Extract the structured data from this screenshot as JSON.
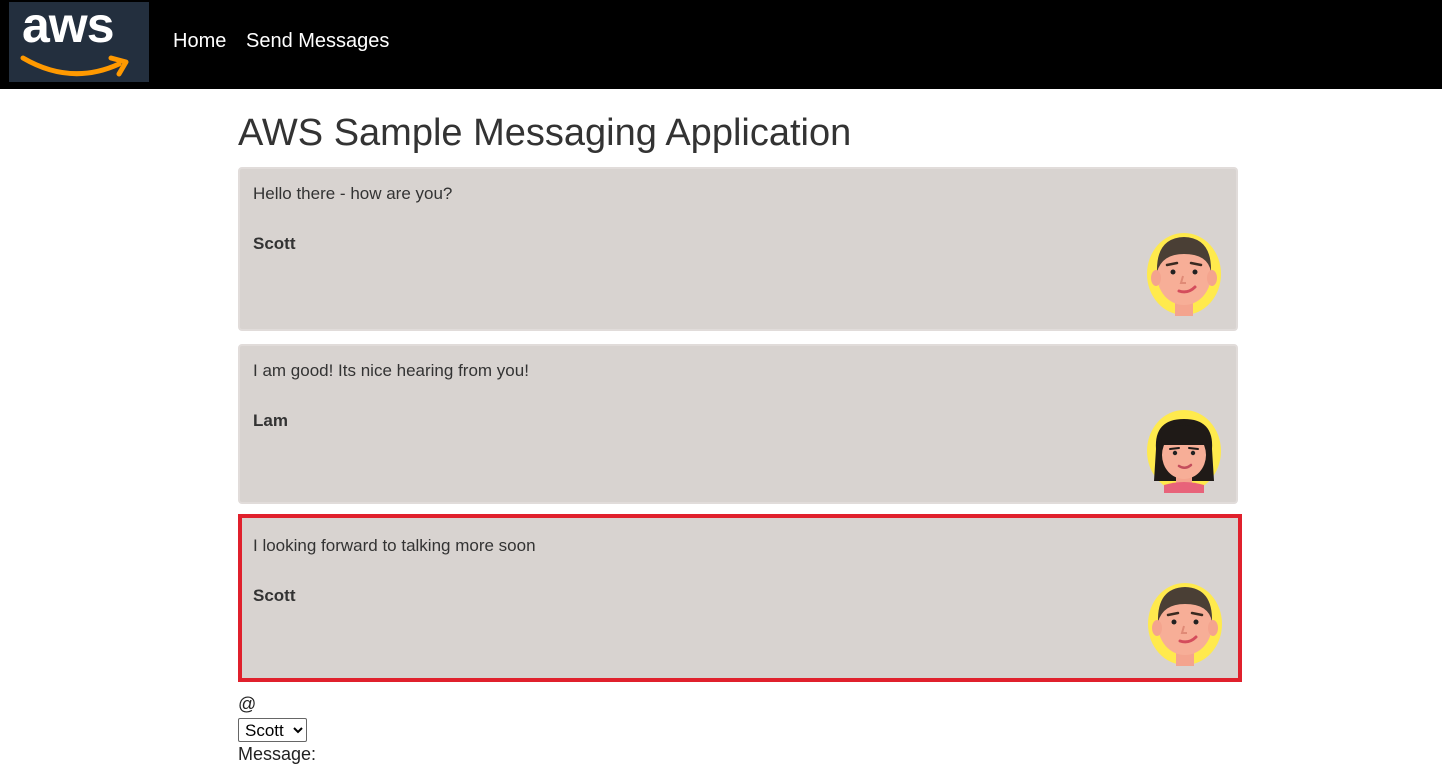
{
  "nav": {
    "logo_text": "aws",
    "links": [
      "Home",
      "Send Messages"
    ]
  },
  "page": {
    "title": "AWS Sample Messaging Application"
  },
  "messages": [
    {
      "text": "Hello there - how are you?",
      "author": "Scott",
      "avatar": "male-avatar-icon"
    },
    {
      "text": "I am good! Its nice hearing from you!",
      "author": "Lam",
      "avatar": "female-avatar-icon"
    },
    {
      "text": "I looking forward to talking more soon",
      "author": "Scott",
      "avatar": "male-avatar-icon",
      "selected": true
    }
  ],
  "form": {
    "at_label": "@",
    "user_select_value": "Scott",
    "message_label": "Message:"
  },
  "colors": {
    "header_bg": "#000000",
    "message_bg": "#d8d3d0",
    "selected_border": "#e0202c",
    "amazon_smile": "#ff9900",
    "avatar_ring": "#ffea4d"
  }
}
